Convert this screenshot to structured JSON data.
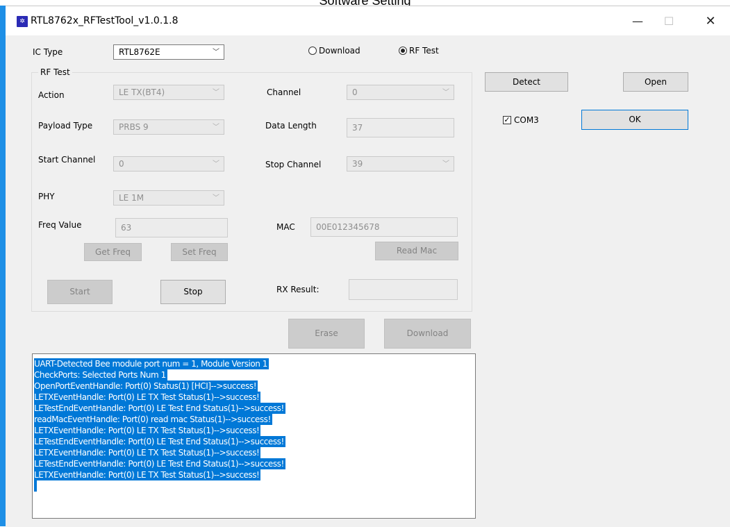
{
  "document": {
    "title": "Software Setting"
  },
  "window": {
    "title": "RTL8762x_RFTestTool_v1.0.1.8",
    "icon": "app-logo-icon",
    "controls": {
      "minimize": "—",
      "maximize": "☐",
      "close": "✕"
    }
  },
  "top": {
    "ic_type_label": "IC Type",
    "ic_type_value": "RTL8762E",
    "mode": {
      "download_label": "Download",
      "rf_test_label": "RF Test",
      "selected": "RF Test"
    }
  },
  "rf_test": {
    "group_label": "RF Test",
    "action": {
      "label": "Action",
      "value": "LE TX(BT4)"
    },
    "channel": {
      "label": "Channel",
      "value": "0"
    },
    "payload_type": {
      "label": "Payload Type",
      "value": "PRBS 9"
    },
    "data_length": {
      "label": "Data Length",
      "value": "37"
    },
    "start_channel": {
      "label": "Start Channel",
      "value": "0"
    },
    "stop_channel": {
      "label": "Stop Channel",
      "value": "39"
    },
    "phy": {
      "label": "PHY",
      "value": "LE 1M"
    },
    "freq_value": {
      "label": "Freq Value",
      "value": "63"
    },
    "mac": {
      "label": "MAC",
      "value": "00E012345678"
    },
    "buttons": {
      "get_freq": "Get Freq",
      "set_freq": "Set Freq",
      "read_mac": "Read Mac",
      "start": "Start",
      "stop": "Stop"
    },
    "rx_result": {
      "label": "RX Result:",
      "value": ""
    }
  },
  "actions": {
    "erase": "Erase",
    "download": "Download"
  },
  "right_panel": {
    "detect": "Detect",
    "open": "Open",
    "com_label": "COM3",
    "com_checked": true,
    "ok": "OK"
  },
  "log": {
    "lines": [
      "UART-Detected Bee module port num = 1, Module Version 1",
      "CheckPorts: Selected Ports Num 1",
      "OpenPortEventHandle: Port(0) Status(1) [HCI]-->success!",
      "LETXEventHandle: Port(0) LE TX Test Status(1)-->success!",
      "LETestEndEventHandle: Port(0) LE Test End Status(1)-->success!",
      "readMacEventHandle:  Port(0) read mac Status(1)-->success!",
      "LETXEventHandle: Port(0) LE TX Test Status(1)-->success!",
      "LETestEndEventHandle: Port(0) LE Test End Status(1)-->success!",
      "LETXEventHandle: Port(0) LE TX Test Status(1)-->success!",
      "LETestEndEventHandle: Port(0) LE Test End Status(1)-->success!",
      "LETXEventHandle: Port(0) LE TX Test Status(1)-->success!"
    ]
  },
  "colors": {
    "accent": "#0078d7",
    "window_bg": "#f0f0f0",
    "left_bar": "#1e8fe6",
    "disabled_text": "#838383"
  }
}
